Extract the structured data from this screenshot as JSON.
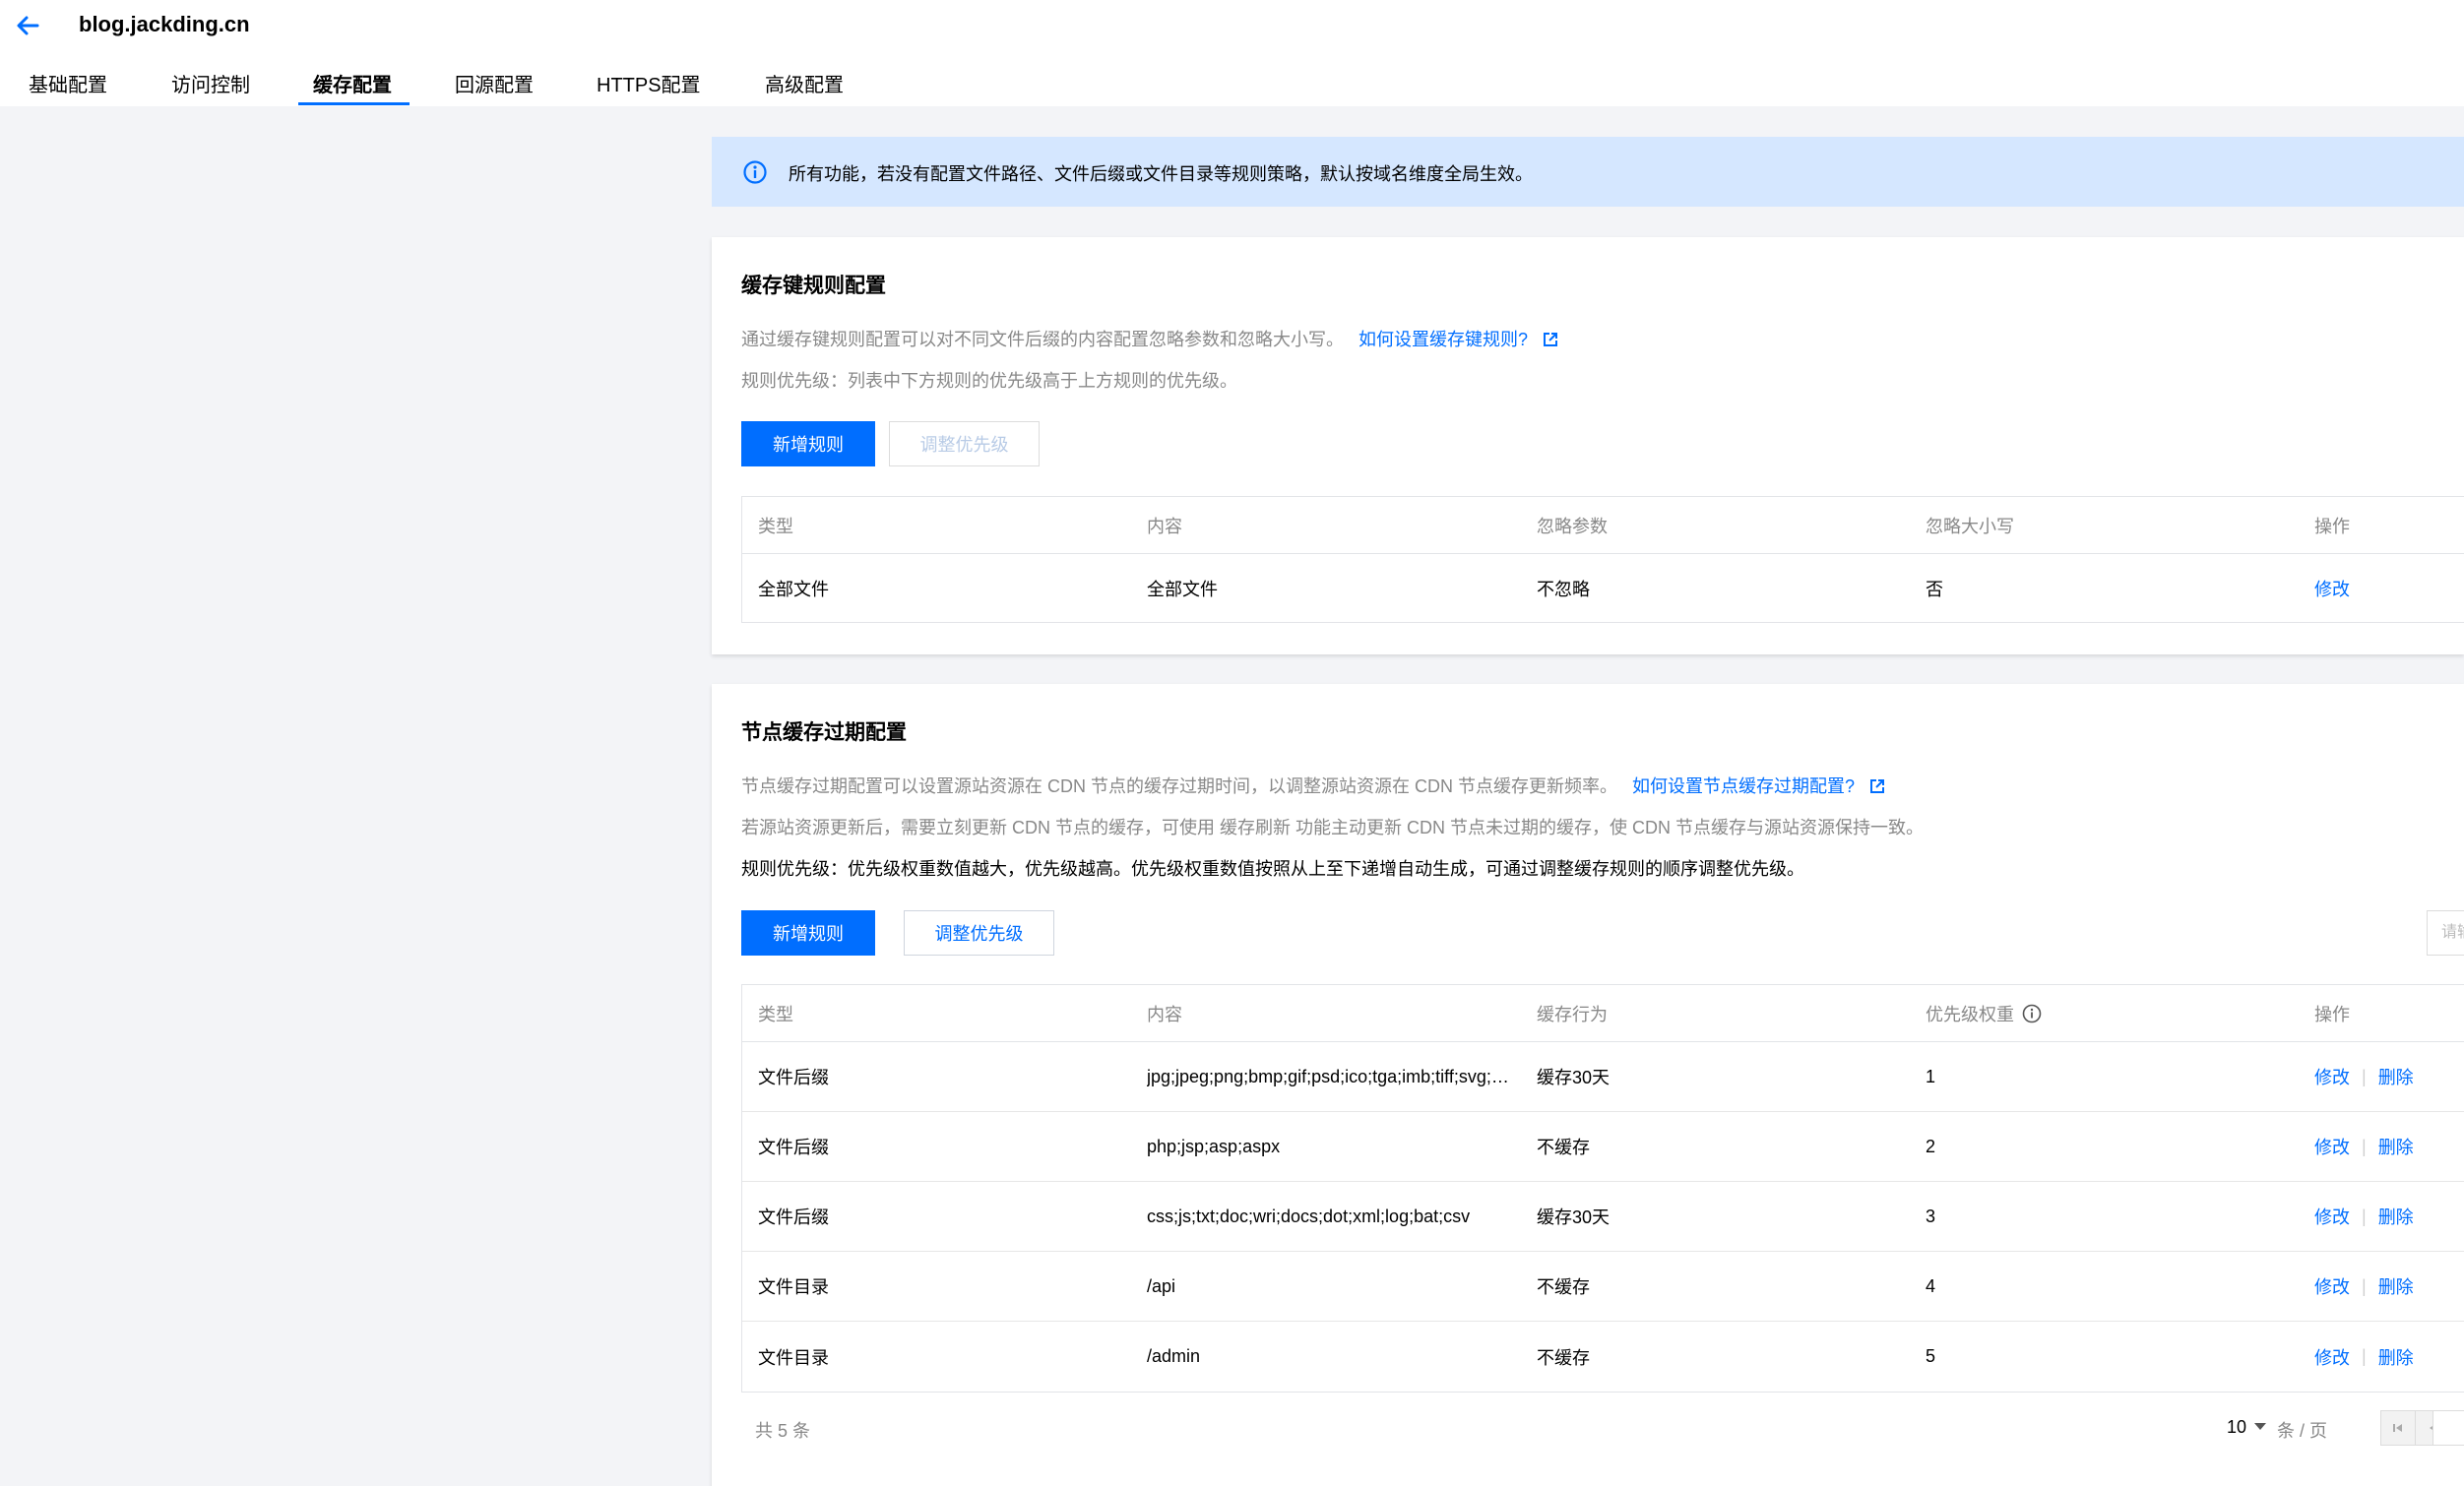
{
  "header": {
    "back_icon": "arrow-left-icon",
    "title": "blog.jackding.cn",
    "tabs": [
      {
        "label": "基础配置",
        "active": false
      },
      {
        "label": "访问控制",
        "active": false
      },
      {
        "label": "缓存配置",
        "active": true
      },
      {
        "label": "回源配置",
        "active": false
      },
      {
        "label": "HTTPS配置",
        "active": false
      },
      {
        "label": "高级配置",
        "active": false
      }
    ]
  },
  "banner": {
    "icon": "info-icon",
    "text": "所有功能，若没有配置文件路径、文件后缀或文件目录等规则策略，默认按域名维度全局生效。"
  },
  "cache_key": {
    "title": "缓存键规则配置",
    "desc1": "通过缓存键规则配置可以对不同文件后缀的内容配置忽略参数和忽略大小写。",
    "help_link": "如何设置缓存键规则?",
    "desc2": "规则优先级：列表中下方规则的优先级高于上方规则的优先级。",
    "add_button": "新增规则",
    "priority_button": "调整优先级",
    "columns": [
      "类型",
      "内容",
      "忽略参数",
      "忽略大小写",
      "操作"
    ],
    "rows": [
      {
        "type": "全部文件",
        "content": "全部文件",
        "ignore_params": "不忽略",
        "ignore_case": "否",
        "action": "修改"
      }
    ]
  },
  "node_cache": {
    "title": "节点缓存过期配置",
    "desc1": "节点缓存过期配置可以设置源站资源在 CDN 节点的缓存过期时间，以调整源站资源在 CDN 节点缓存更新频率。",
    "help_link": "如何设置节点缓存过期配置?",
    "desc2": "若源站资源更新后，需要立刻更新 CDN 节点的缓存，可使用 缓存刷新 功能主动更新 CDN 节点未过期的缓存，使 CDN 节点缓存与源站资源保持一致。",
    "desc3": "规则优先级：优先级权重数值越大，优先级越高。优先级权重数值按照从上至下递增自动生成，可通过调整缓存规则的顺序调整优先级。",
    "add_button": "新增规则",
    "priority_button": "调整优先级",
    "search_placeholder": "请输",
    "columns": [
      "类型",
      "内容",
      "缓存行为",
      "优先级权重",
      "操作"
    ],
    "rows": [
      {
        "type": "文件后缀",
        "content": "jpg;jpeg;png;bmp;gif;psd;ico;tga;imb;tiff;svg;webp;fla;flv;swf",
        "behavior": "缓存30天",
        "weight": "1",
        "edit": "修改",
        "delete": "删除"
      },
      {
        "type": "文件后缀",
        "content": "php;jsp;asp;aspx",
        "behavior": "不缓存",
        "weight": "2",
        "edit": "修改",
        "delete": "删除"
      },
      {
        "type": "文件后缀",
        "content": "css;js;txt;doc;wri;docs;dot;xml;log;bat;csv",
        "behavior": "缓存30天",
        "weight": "3",
        "edit": "修改",
        "delete": "删除"
      },
      {
        "type": "文件目录",
        "content": "/api",
        "behavior": "不缓存",
        "weight": "4",
        "edit": "修改",
        "delete": "删除"
      },
      {
        "type": "文件目录",
        "content": "/admin",
        "behavior": "不缓存",
        "weight": "5",
        "edit": "修改",
        "delete": "删除"
      }
    ],
    "pagination": {
      "total_text": "共 5 条",
      "page_size": "10",
      "unit": "条 / 页"
    }
  },
  "colors": {
    "primary": "#006eff",
    "banner_bg": "#d5e7ff",
    "page_bg": "#f3f4f7"
  }
}
